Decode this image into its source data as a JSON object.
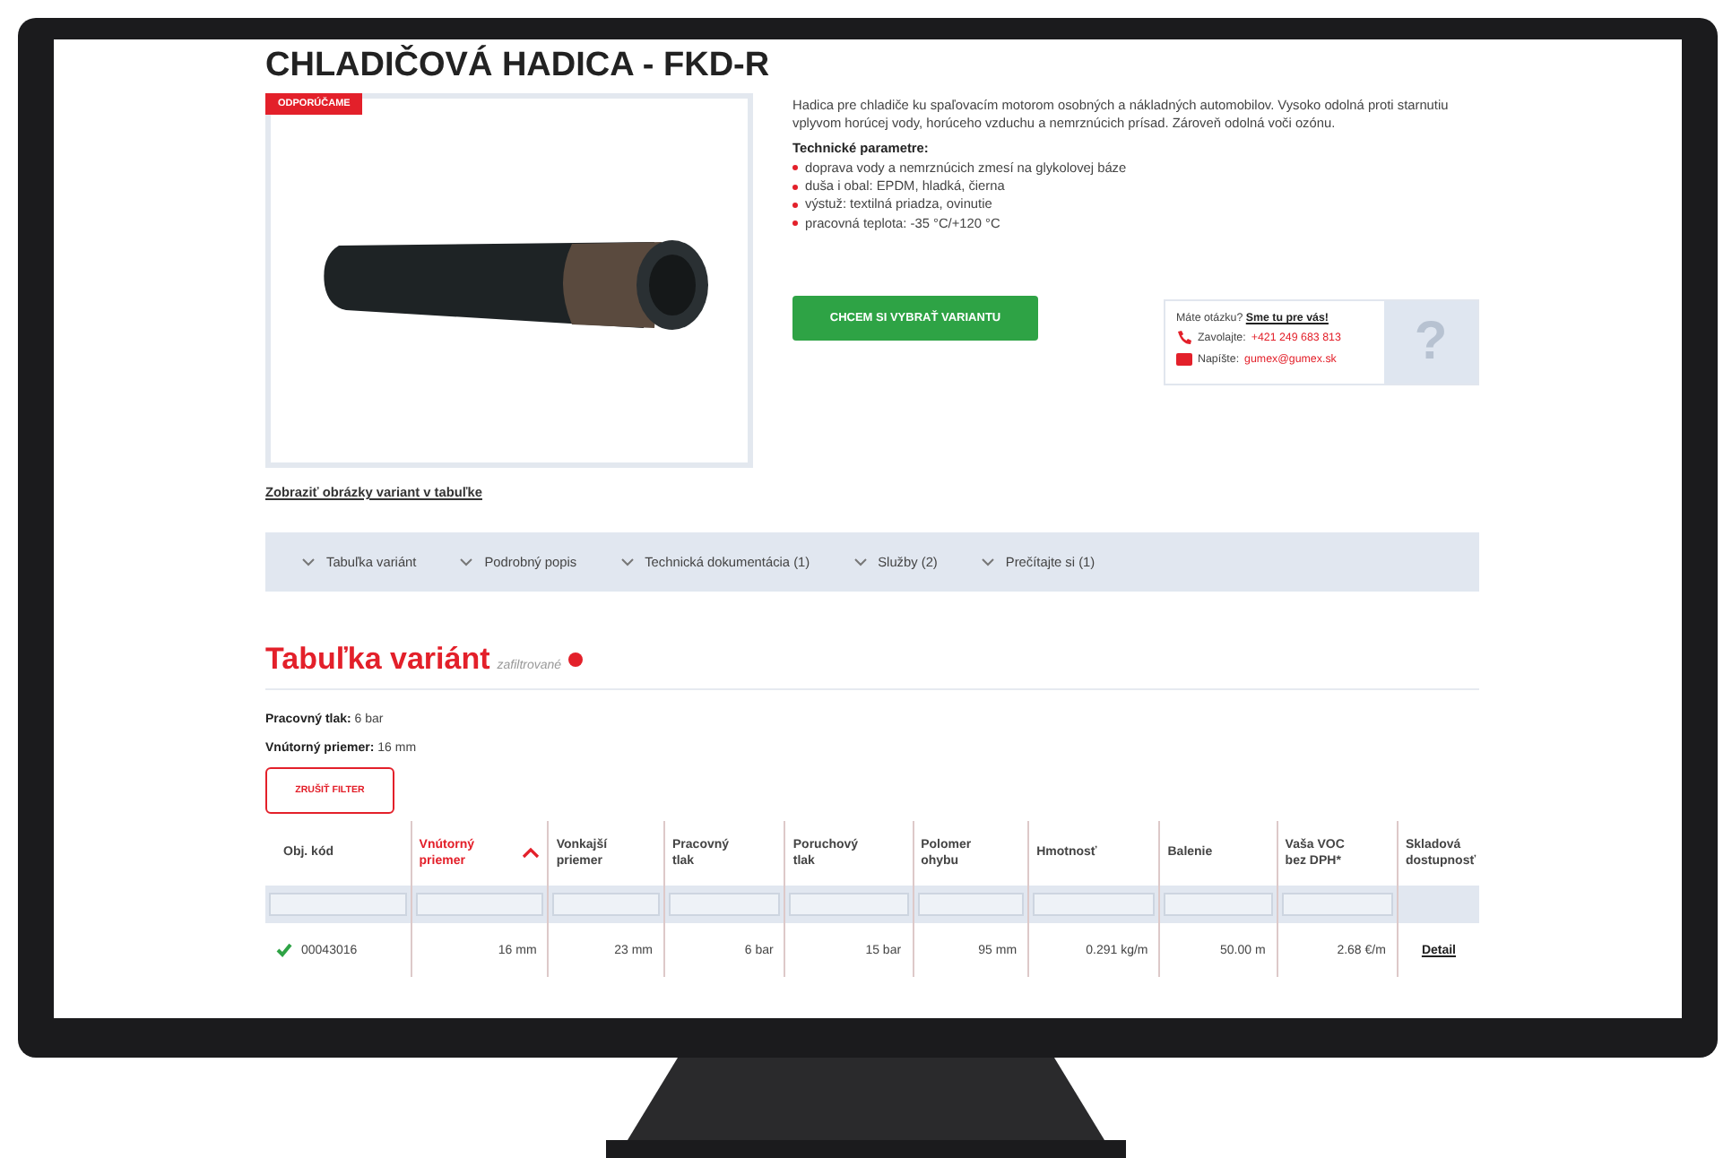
{
  "product": {
    "title": "CHLADIČOVÁ HADICA - FKD-R",
    "badge": "ODPORÚČAME",
    "images_link": "Zobraziť obrázky variant v tabuľke",
    "description": "Hadica pre chladiče ku spaľovacím motorom osobných a nákladných automobilov. Vysoko odolná proti starnutiu vplyvom horúcej vody, horúceho vzduchu a nemrznúcich prísad. Zároveň odolná voči ozónu.",
    "params_heading": "Technické parametre:",
    "params": [
      "doprava vody a nemrznúcich zmesí na glykolovej báze",
      "duša i obal: EPDM, hladká, čierna",
      "výstuž: textilná priadza, ovinutie",
      "pracovná teplota: -35 °C/+120 °C"
    ],
    "choose_button": "CHCEM SI VYBRAŤ VARIANTU"
  },
  "help": {
    "question": "Máte otázku?",
    "link": "Sme tu pre vás!",
    "call_label": "Zavolajte:",
    "phone": "+421 249 683 813",
    "write_label": "Napíšte:",
    "email": "gumex@gumex.sk",
    "mark": "?"
  },
  "tabs": [
    {
      "label": "Tabuľka variánt"
    },
    {
      "label": "Podrobný popis"
    },
    {
      "label": "Technická dokumentácia (1)"
    },
    {
      "label": "Služby (2)"
    },
    {
      "label": "Prečítajte si (1)"
    }
  ],
  "variants": {
    "heading": "Tabuľka variánt",
    "filtered": "zafiltrované",
    "filters": [
      {
        "label": "Pracovný tlak:",
        "value": "6 bar"
      },
      {
        "label": "Vnútorný priemer:",
        "value": "16 mm"
      }
    ],
    "clear_button": "ZRUŠIŤ FILTER",
    "columns": [
      {
        "label": "Obj. kód",
        "sorted": false,
        "filterable": true
      },
      {
        "label": "Vnútorný priemer",
        "sorted": true,
        "filterable": true
      },
      {
        "label": "Vonkajší priemer",
        "sorted": false,
        "filterable": true
      },
      {
        "label": "Pracovný tlak",
        "sorted": false,
        "filterable": true
      },
      {
        "label": "Poruchový tlak",
        "sorted": false,
        "filterable": true
      },
      {
        "label": "Polomer ohybu",
        "sorted": false,
        "filterable": true
      },
      {
        "label": "Hmotnosť",
        "sorted": false,
        "filterable": true
      },
      {
        "label": "Balenie",
        "sorted": false,
        "filterable": true
      },
      {
        "label": "Vaša VOC bez DPH*",
        "sorted": false,
        "filterable": true
      },
      {
        "label": "Skladová dostupnosť",
        "sorted": false,
        "filterable": false
      }
    ],
    "rows": [
      {
        "available": true,
        "cells": [
          "00043016",
          "16 mm",
          "23 mm",
          "6 bar",
          "15 bar",
          "95 mm",
          "0.291 kg/m",
          "50.00 m",
          "2.68 €/m"
        ],
        "link": "Detail"
      }
    ]
  }
}
